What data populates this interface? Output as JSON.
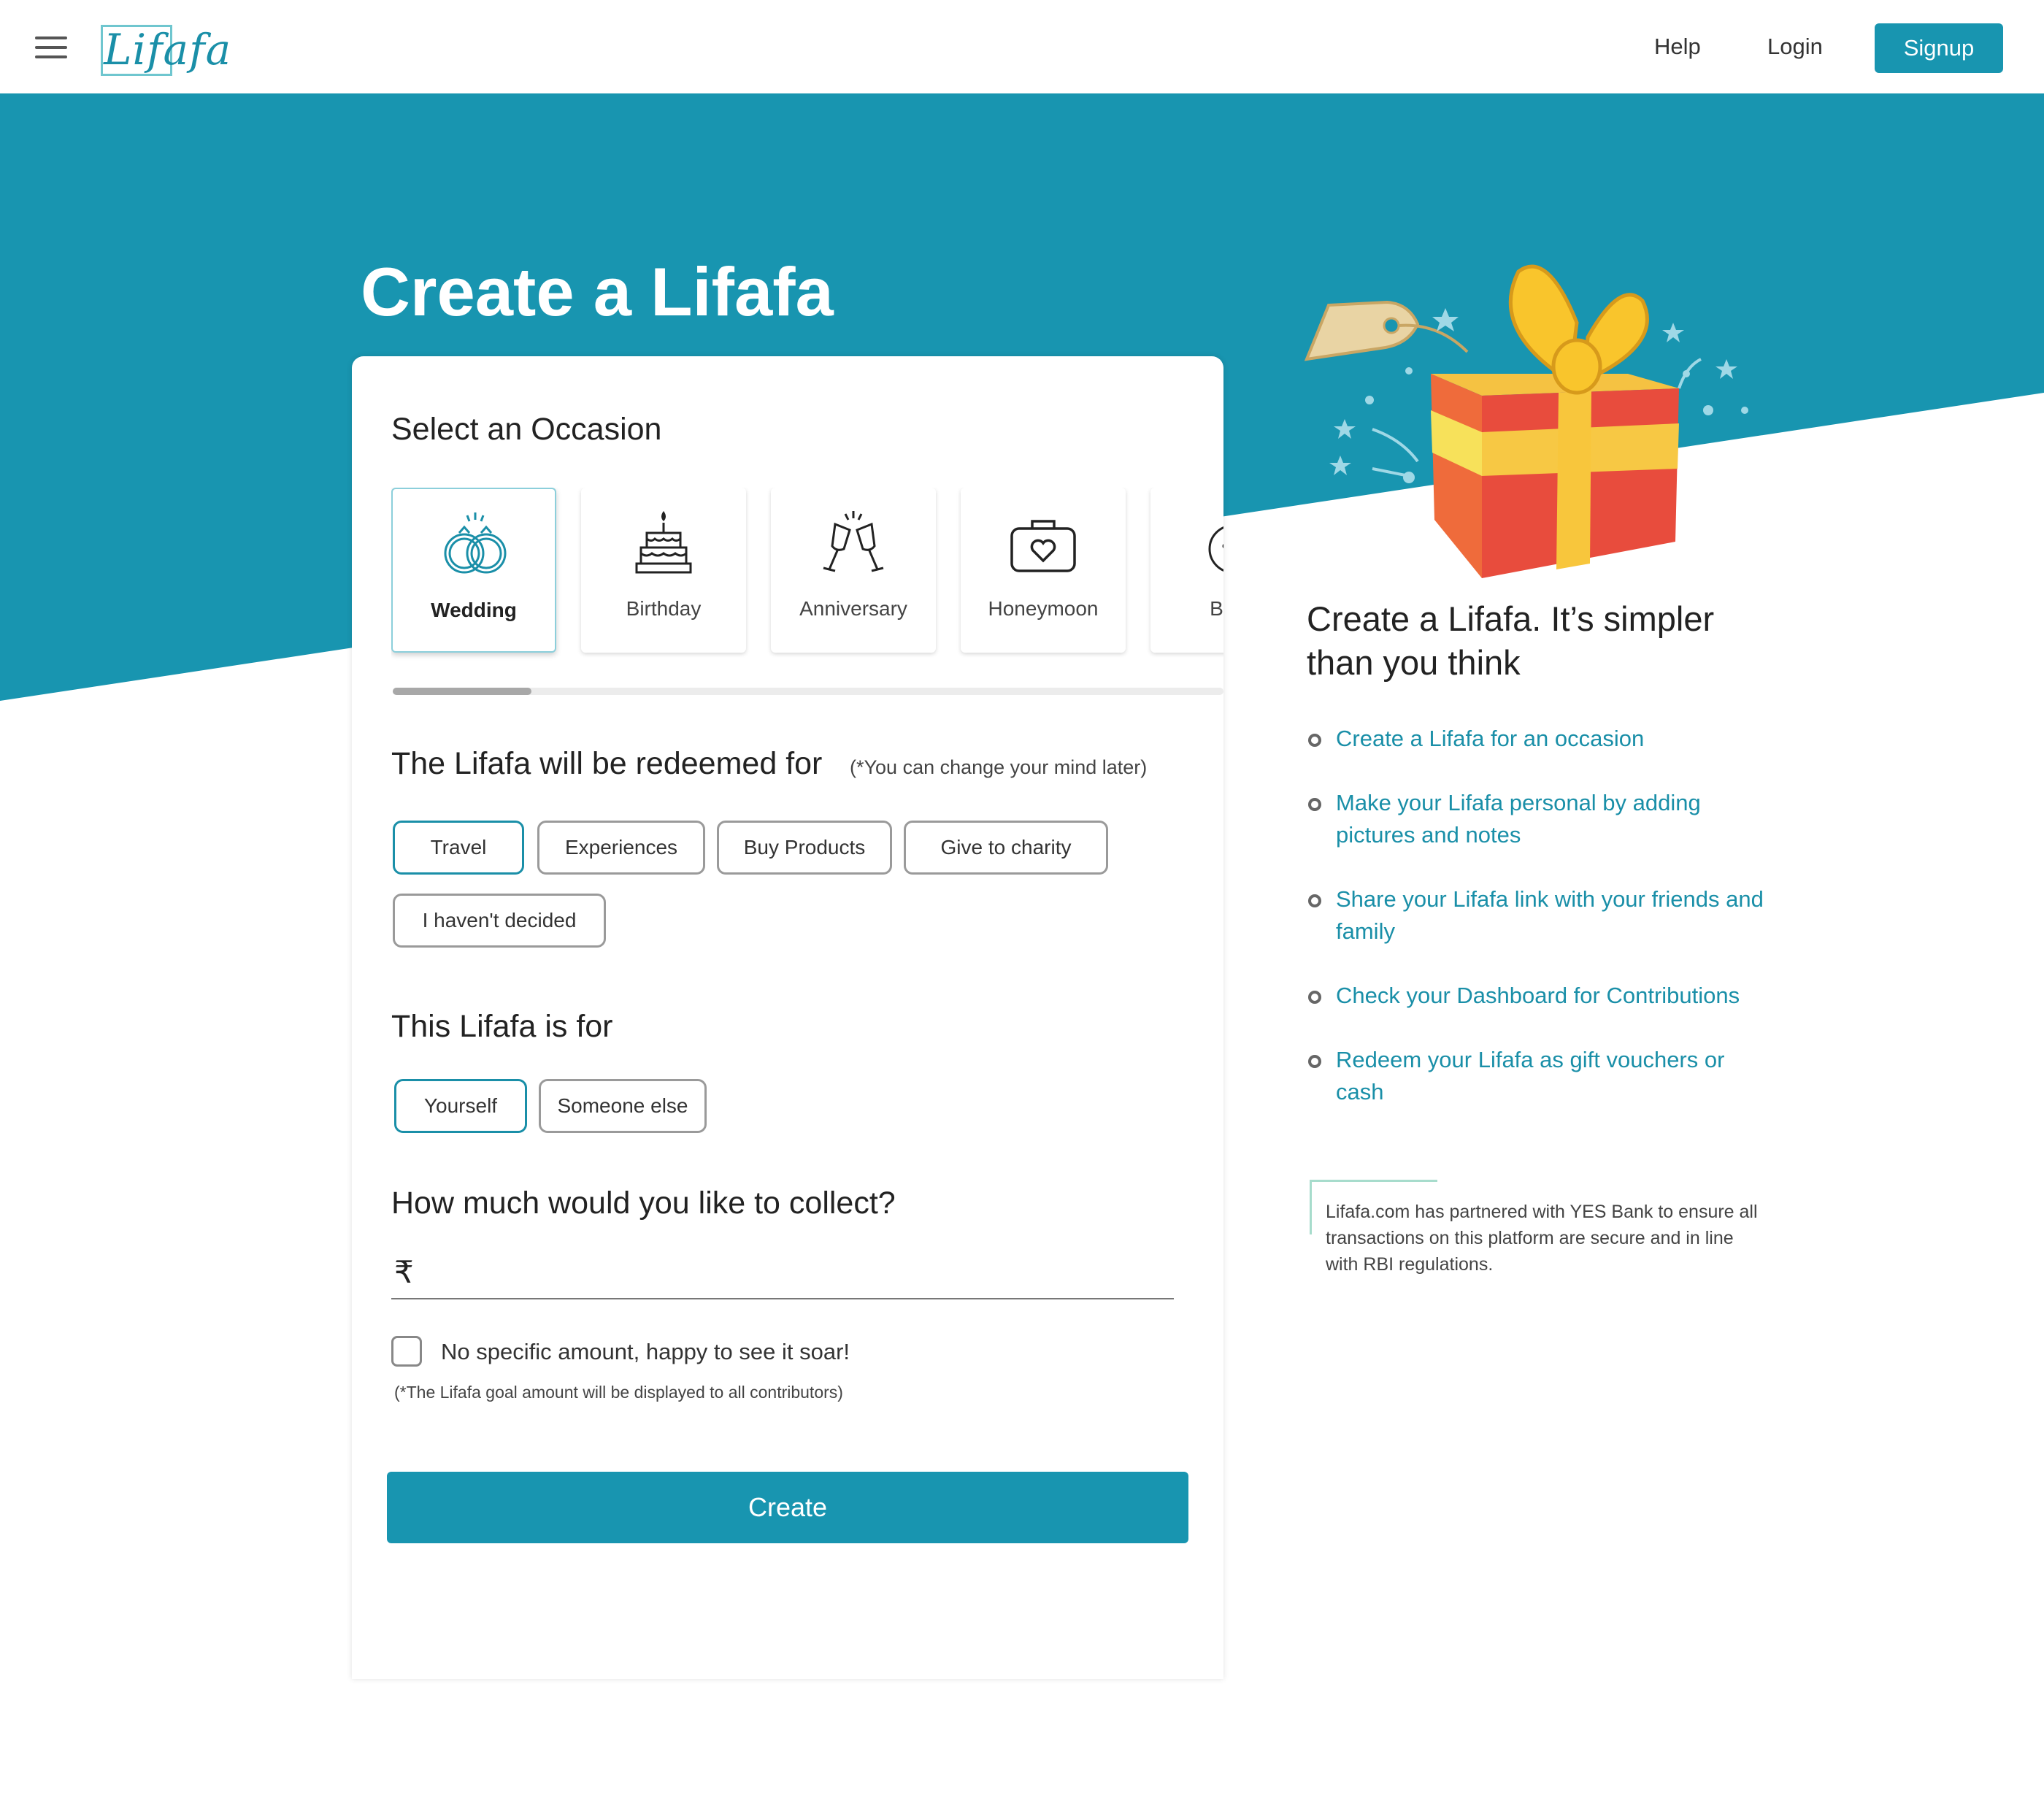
{
  "header": {
    "logo_text": "Lifafa",
    "nav": {
      "help": "Help",
      "login": "Login",
      "signup": "Signup"
    }
  },
  "page": {
    "title": "Create a Lifafa"
  },
  "form": {
    "occasion_title": "Select an Occasion",
    "occasions": [
      {
        "label": "Wedding",
        "icon": "wedding-rings-icon",
        "selected": true
      },
      {
        "label": "Birthday",
        "icon": "birthday-cake-icon",
        "selected": false
      },
      {
        "label": "Anniversary",
        "icon": "champagne-glasses-icon",
        "selected": false
      },
      {
        "label": "Honeymoon",
        "icon": "suitcase-heart-icon",
        "selected": false
      },
      {
        "label": "Baby",
        "icon": "baby-face-icon",
        "selected": false
      }
    ],
    "redeem_title": "The Lifafa will be redeemed for",
    "redeem_note": "(*You can change your mind later)",
    "redeem_options": [
      "Travel",
      "Experiences",
      "Buy Products",
      "Give to charity",
      "I haven't decided"
    ],
    "redeem_selected": "Travel",
    "for_title": "This Lifafa is for",
    "for_options": [
      "Yourself",
      "Someone else"
    ],
    "for_selected": "Yourself",
    "amount_title": "How much would you like to collect?",
    "currency_symbol": "₹",
    "amount_value": "",
    "no_amount_label": "No specific amount, happy to see it soar!",
    "no_amount_checked": false,
    "goal_note": "(*The Lifafa goal amount will be displayed to all contributors)",
    "create_label": "Create"
  },
  "info": {
    "title": "Create a Lifafa. It’s simpler than you think",
    "steps": [
      "Create a Lifafa for an occasion",
      "Make your Lifafa personal by adding pictures and notes",
      "Share your Lifafa link with your friends and family",
      "Check your Dashboard for Contributions",
      "Redeem your Lifafa as gift vouchers or cash"
    ],
    "partner_text": "Lifafa.com has partnered with YES Bank to ensure all transactions on this platform are secure and in line with RBI regulations."
  },
  "colors": {
    "brand": "#1895b0",
    "hero_bg": "#1895b0",
    "link": "#1a8fa8",
    "selected_border": "#1a8fa8"
  }
}
